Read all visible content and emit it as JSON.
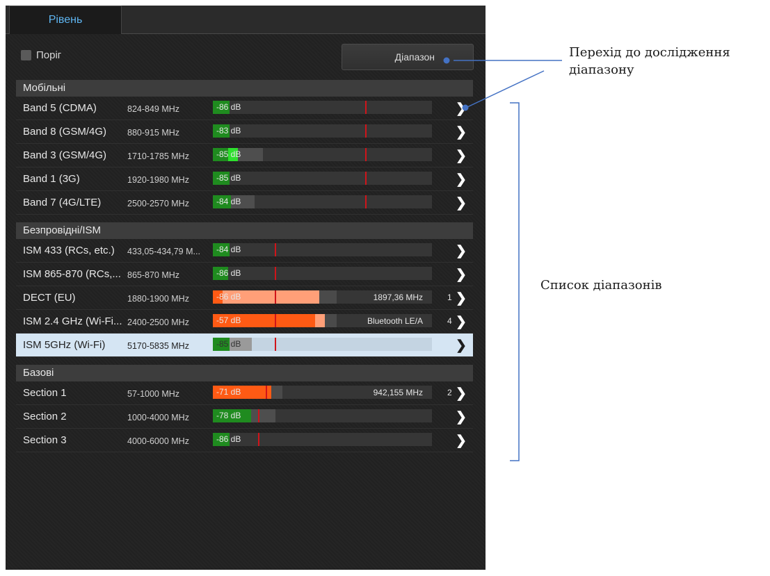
{
  "tab": {
    "label": "Рівень"
  },
  "threshold": {
    "label": "Поріг",
    "checked": false
  },
  "range_button": {
    "label": "Діапазон"
  },
  "sections": [
    {
      "title": "Мобільні",
      "rows": [
        {
          "name": "Band 5 (CDMA)",
          "freq": "824-849 MHz",
          "level": "-86 dB",
          "info": "",
          "count": ""
        },
        {
          "name": "Band 8 (GSM/4G)",
          "freq": "880-915 MHz",
          "level": "-83 dB",
          "info": "",
          "count": ""
        },
        {
          "name": "Band 3 (GSM/4G)",
          "freq": "1710-1785 MHz",
          "level": "-85 dB",
          "info": "",
          "count": ""
        },
        {
          "name": "Band 1 (3G)",
          "freq": "1920-1980 MHz",
          "level": "-85 dB",
          "info": "",
          "count": ""
        },
        {
          "name": "Band 7 (4G/LTE)",
          "freq": "2500-2570 MHz",
          "level": "-84 dB",
          "info": "",
          "count": ""
        }
      ]
    },
    {
      "title": "Безпровідні/ISM",
      "rows": [
        {
          "name": "ISM 433 (RCs, etc.)",
          "freq": "433,05-434,79 M...",
          "level": "-84 dB",
          "info": "",
          "count": ""
        },
        {
          "name": "ISM 865-870 (RCs,...",
          "freq": "865-870 MHz",
          "level": "-86 dB",
          "info": "",
          "count": ""
        },
        {
          "name": "DECT (EU)",
          "freq": "1880-1900 MHz",
          "level": "-86 dB",
          "info": "1897,36 MHz",
          "count": "1"
        },
        {
          "name": "ISM 2.4 GHz (Wi-Fi...",
          "freq": "2400-2500 MHz",
          "level": "-57 dB",
          "info": "Bluetooth LE/A",
          "count": "4"
        },
        {
          "name": "ISM 5GHz (Wi-Fi)",
          "freq": "5170-5835 MHz",
          "level": "-85 dB",
          "info": "",
          "count": "",
          "selected": true
        }
      ]
    },
    {
      "title": "Базові",
      "rows": [
        {
          "name": "Section 1",
          "freq": "57-1000 MHz",
          "level": "-71 dB",
          "info": "942,155 MHz",
          "count": "2"
        },
        {
          "name": "Section 2",
          "freq": "1000-4000 MHz",
          "level": "-78 dB",
          "info": "",
          "count": ""
        },
        {
          "name": "Section 3",
          "freq": "4000-6000 MHz",
          "level": "-86 dB",
          "info": "",
          "count": ""
        }
      ]
    }
  ],
  "annotations": {
    "range_line1": "Перехід до дослідження",
    "range_line2": "діапазону",
    "list": "Список діапазонів"
  },
  "colors": {
    "tab_text": "#5fb6f2",
    "level_green": "#1f8b1f",
    "level_bright_green": "#2ee02e",
    "level_orange": "#ff5a14",
    "peak_salmon": "#ff9f78",
    "marker_red": "#d0141a",
    "annotation_line": "#4472c4"
  }
}
